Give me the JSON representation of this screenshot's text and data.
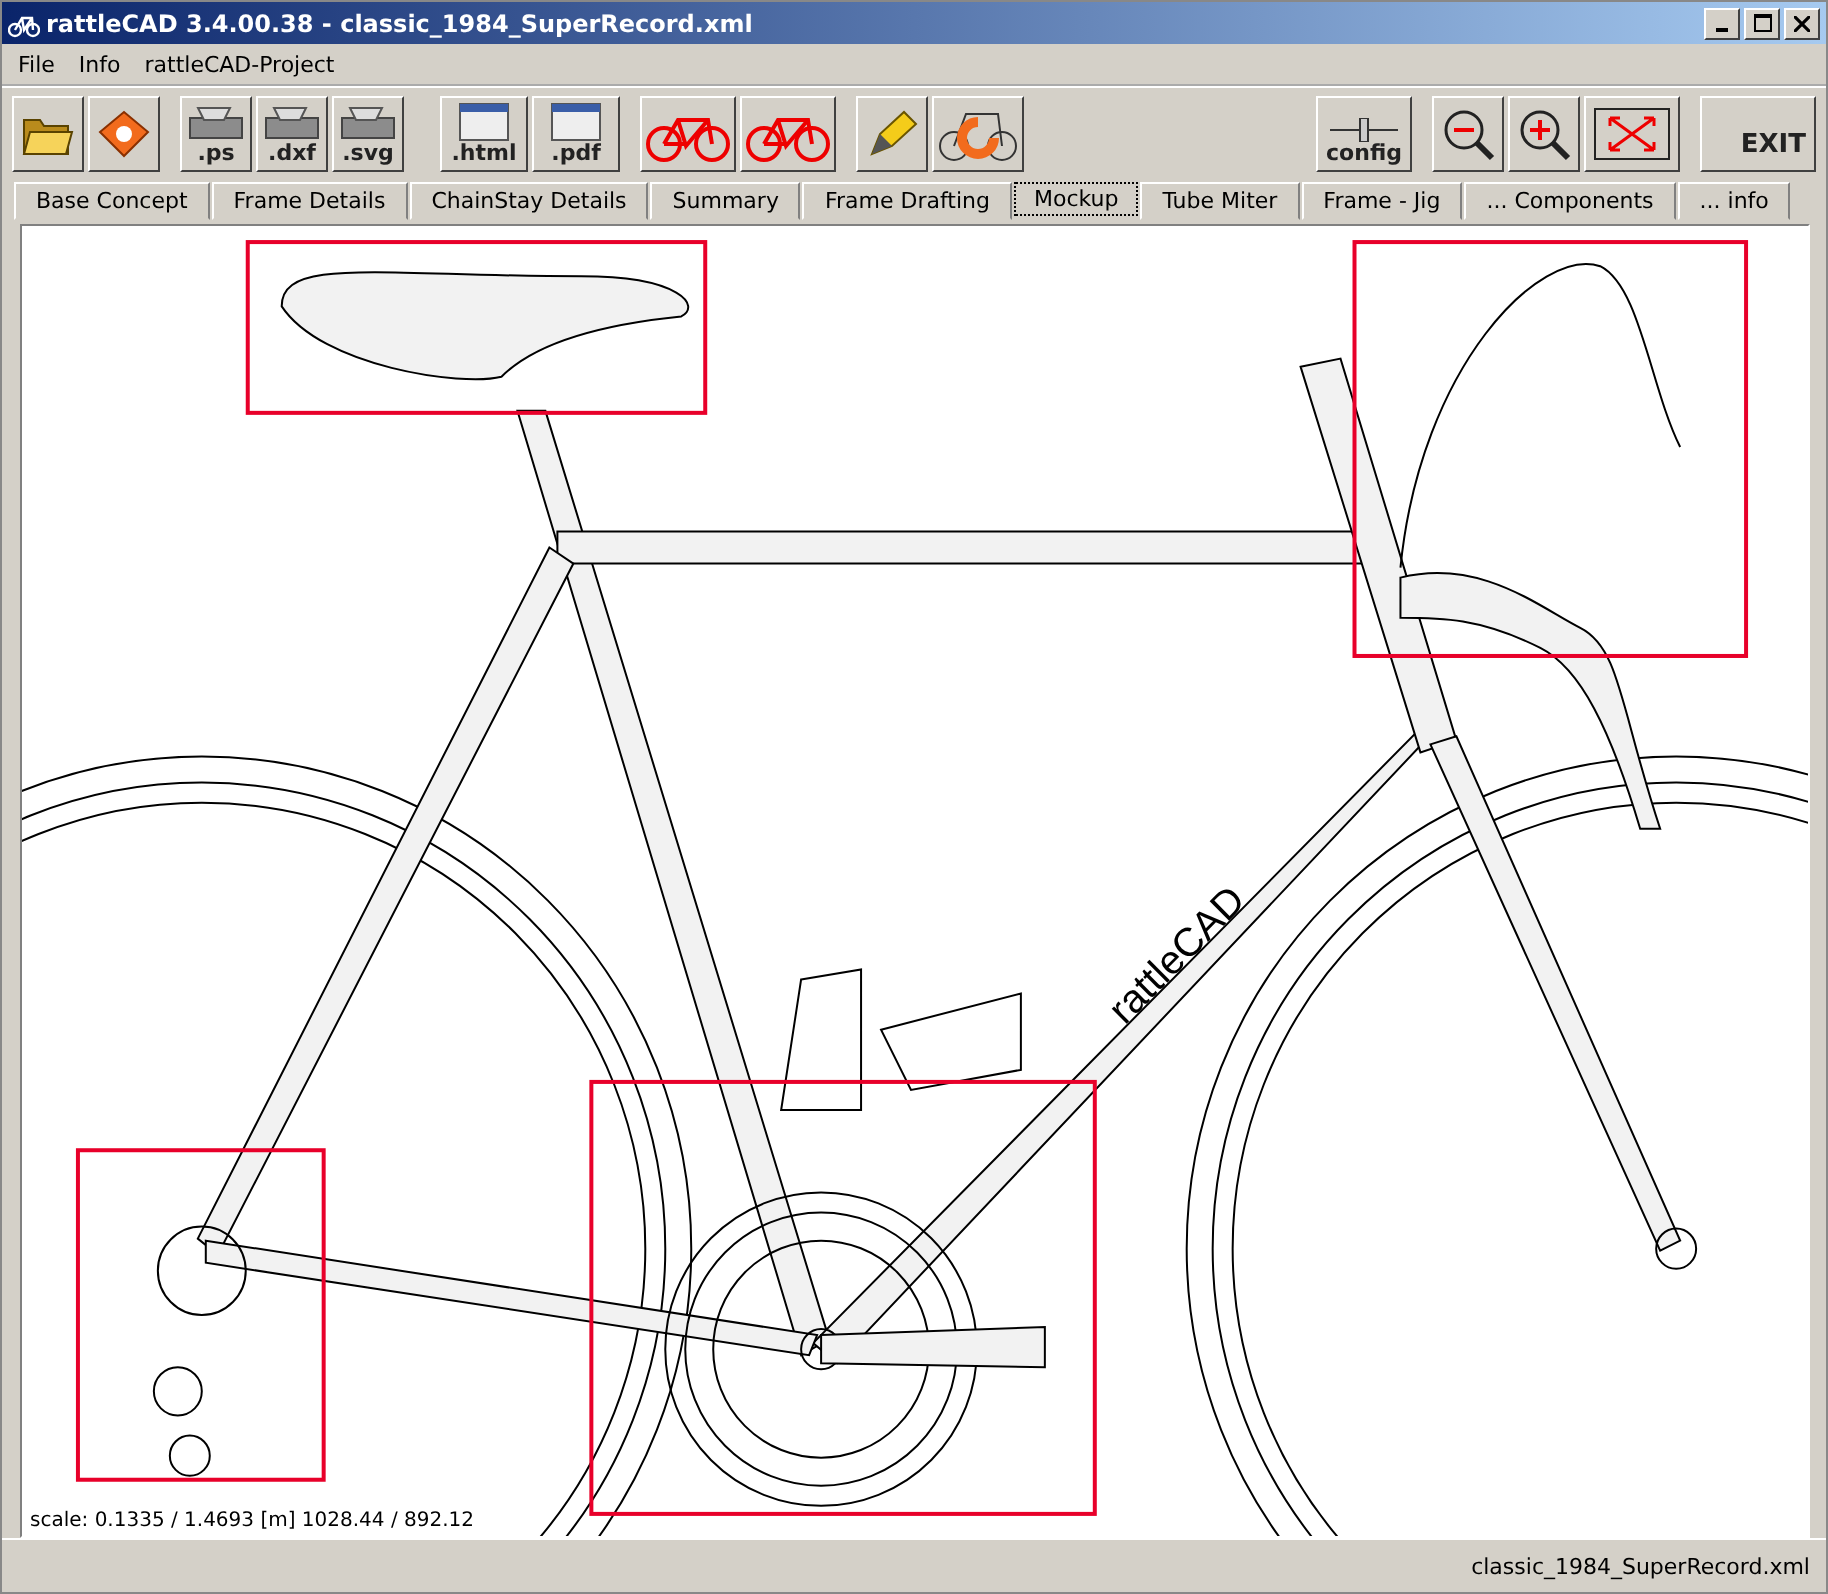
{
  "window": {
    "title": "rattleCAD  3.4.00.38 - classic_1984_SuperRecord.xml"
  },
  "menu": [
    "File",
    "Info",
    "rattleCAD-Project"
  ],
  "toolbar": [
    {
      "kind": "open"
    },
    {
      "kind": "save"
    },
    {
      "kind": "export",
      "label": ".ps"
    },
    {
      "kind": "export",
      "label": ".dxf"
    },
    {
      "kind": "export",
      "label": ".svg"
    },
    {
      "kind": "doc",
      "label": ".html"
    },
    {
      "kind": "doc",
      "label": ".pdf"
    },
    {
      "kind": "bike"
    },
    {
      "kind": "bike"
    },
    {
      "kind": "pencil"
    },
    {
      "kind": "reload"
    },
    {
      "kind": "spacer"
    },
    {
      "kind": "config",
      "label": "config"
    },
    {
      "kind": "zoomout"
    },
    {
      "kind": "zoomin"
    },
    {
      "kind": "fit"
    },
    {
      "kind": "exit",
      "label": "EXIT"
    }
  ],
  "tabs": [
    {
      "label": "Base Concept",
      "selected": false
    },
    {
      "label": "Frame Details",
      "selected": false
    },
    {
      "label": "ChainStay Details",
      "selected": false
    },
    {
      "label": "Summary",
      "selected": false
    },
    {
      "label": "Frame Drafting",
      "selected": false
    },
    {
      "label": "Mockup",
      "selected": true
    },
    {
      "label": "Tube Miter",
      "selected": false
    },
    {
      "label": "Frame - Jig",
      "selected": false
    },
    {
      "label": "... Components",
      "selected": false
    },
    {
      "label": "... info",
      "selected": false
    }
  ],
  "canvas": {
    "frame_logo": "rattleCAD",
    "scale_info": "scale: 0.1335 / 1.4693  [m]  1028.44 / 892.12"
  },
  "status_bar": "classic_1984_SuperRecord.xml"
}
